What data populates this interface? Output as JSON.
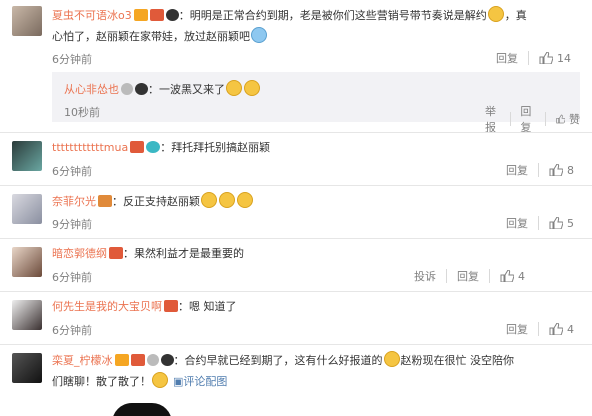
{
  "comments": [
    {
      "name": "夏虫不可语冰o3",
      "colon": "：",
      "text1": "明明是正常合约到期，老是被你们这些营销号带节奏说是解约",
      "text1b": "，真",
      "text2": "心怕了，赵丽颖在家带娃，放过赵丽颖吧",
      "time": "6分钟前",
      "reply": "回复",
      "likes": "14"
    },
    {
      "name": "ttttttttttttmua",
      "colon": "：",
      "text1": "拜托拜托别搞赵丽颖",
      "time": "6分钟前",
      "reply": "回复",
      "likes": "8"
    },
    {
      "name": "奈菲尔光",
      "colon": "：",
      "text1": "反正支持赵丽颖",
      "time": "9分钟前",
      "reply": "回复",
      "likes": "5"
    },
    {
      "name": "暗恋郭德纲",
      "colon": "：",
      "text1": "果然利益才是最重要的",
      "time": "6分钟前",
      "report": "投诉",
      "reply": "回复",
      "likes": "4"
    },
    {
      "name": "何先生是我的大宝贝啊",
      "colon": "：",
      "text1": "嗯 知道了",
      "time": "6分钟前",
      "reply": "回复",
      "likes": "4"
    },
    {
      "name": "栾夏_柠檬冰",
      "colon": "：",
      "text1": "合约早就已经到期了，这有什么好报道的",
      "text1b": "赵粉现在很忙 没空陪你",
      "text2": "们瞎聊！散了散了！",
      "more": "评论配图"
    }
  ],
  "subreply": {
    "name": "从心非怂也",
    "colon": "：",
    "text": "一波黑又来了",
    "time": "10秒前",
    "report": "举报",
    "reply": "回复",
    "like": "赞"
  },
  "colors": {
    "name": "#eb7350",
    "meta": "#808080",
    "subbg": "#f2f2f5"
  }
}
